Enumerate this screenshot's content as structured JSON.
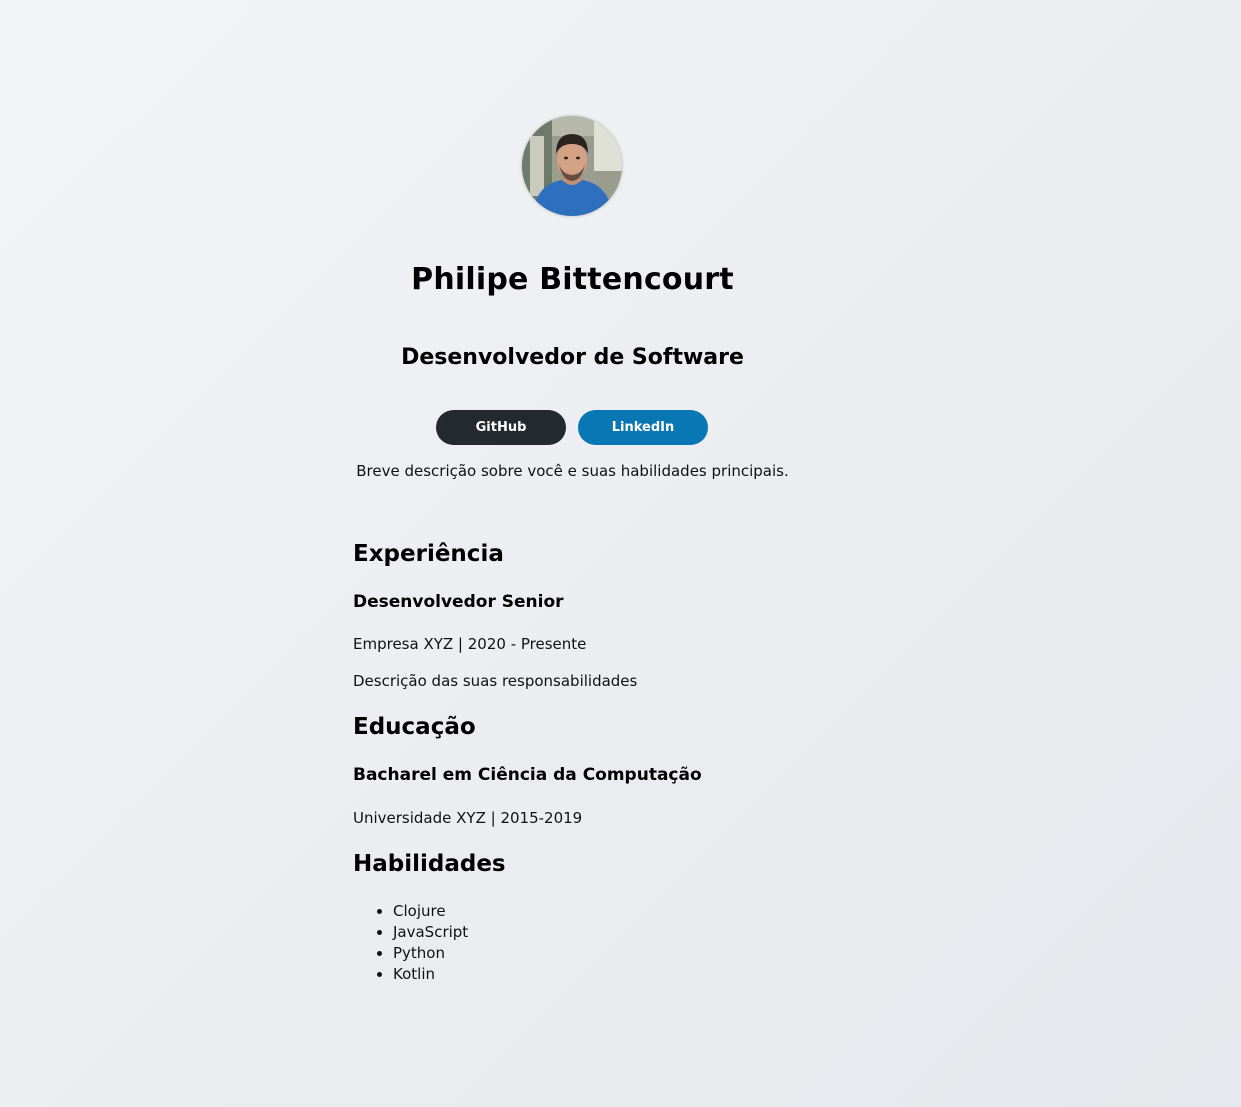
{
  "profile": {
    "name": "Philipe Bittencourt",
    "role": "Desenvolvedor de Software",
    "bio": "Breve descrição sobre você e suas habilidades principais."
  },
  "links": {
    "github_label": "GitHub",
    "linkedin_label": "LinkedIn",
    "github_color": "#24292e",
    "linkedin_color": "#0a77b5"
  },
  "experience": {
    "heading": "Experiência",
    "items": [
      {
        "title": "Desenvolvedor Senior",
        "meta": "Empresa XYZ | 2020 - Presente",
        "description": "Descrição das suas responsabilidades"
      }
    ]
  },
  "education": {
    "heading": "Educação",
    "items": [
      {
        "title": "Bacharel em Ciência da Computação",
        "meta": "Universidade XYZ | 2015-2019"
      }
    ]
  },
  "skills": {
    "heading": "Habilidades",
    "items": [
      "Clojure",
      "JavaScript",
      "Python",
      "Kotlin"
    ]
  }
}
